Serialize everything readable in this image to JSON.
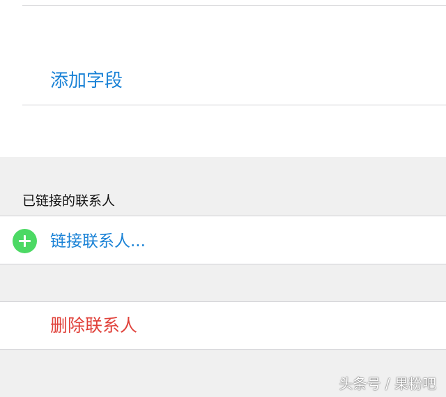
{
  "field_section": {
    "add_field_label": "添加字段"
  },
  "linked_contacts": {
    "header": "已链接的联系人",
    "link_contact_label": "链接联系人..."
  },
  "actions": {
    "delete_contact_label": "删除联系人"
  },
  "watermark": {
    "text": "头条号 / 果粉吧"
  },
  "colors": {
    "accent_blue": "#1a82d6",
    "destructive_red": "#e0413a",
    "add_green": "#4cd964",
    "group_background": "#f0f0f0"
  },
  "icons": {
    "link_contact": "plus-circle-icon"
  }
}
